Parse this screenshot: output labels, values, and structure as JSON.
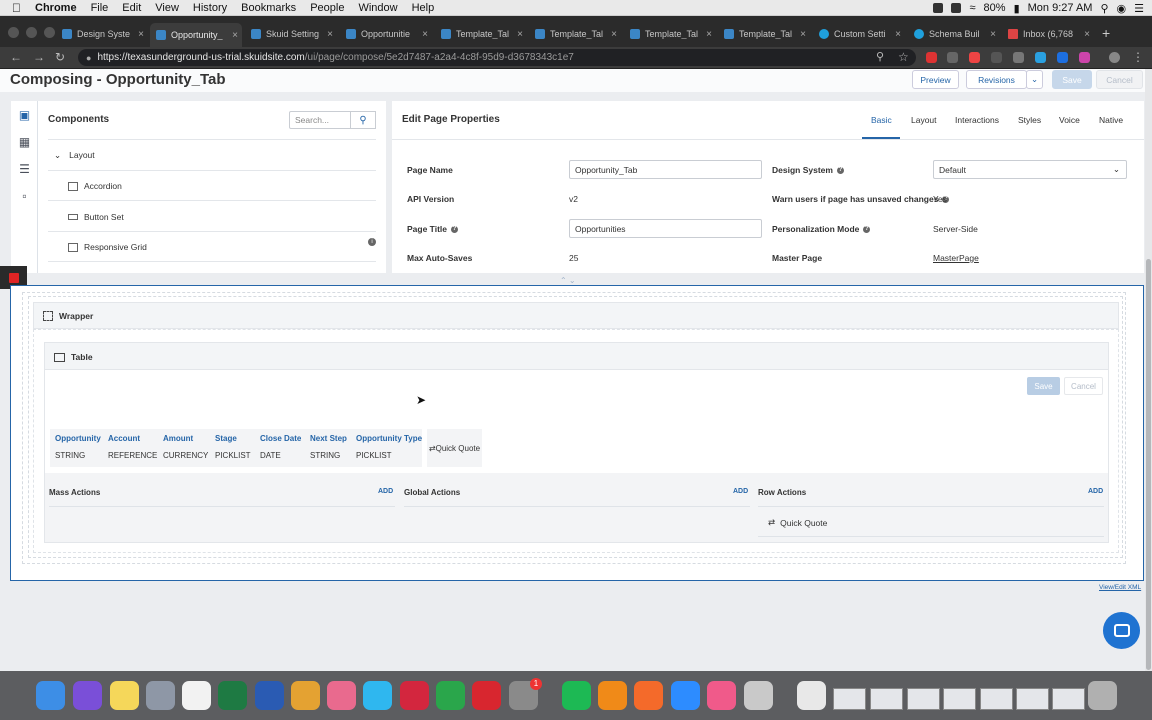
{
  "menubar": {
    "app": "Chrome",
    "items": [
      "File",
      "Edit",
      "View",
      "History",
      "Bookmarks",
      "People",
      "Window",
      "Help"
    ],
    "battery": "80%",
    "clock": "Mon 9:27 AM"
  },
  "tabs": [
    {
      "label": "Design Syste",
      "active": false,
      "icon": "skuid-icon"
    },
    {
      "label": "Opportunity_",
      "active": true,
      "icon": "skuid-icon"
    },
    {
      "label": "Skuid Setting",
      "active": false,
      "icon": "skuid-icon"
    },
    {
      "label": "Opportunitie",
      "active": false,
      "icon": "skuid-icon"
    },
    {
      "label": "Template_Tal",
      "active": false,
      "icon": "skuid-icon"
    },
    {
      "label": "Template_Tal",
      "active": false,
      "icon": "skuid-icon"
    },
    {
      "label": "Template_Tal",
      "active": false,
      "icon": "skuid-icon"
    },
    {
      "label": "Template_Tal",
      "active": false,
      "icon": "skuid-icon"
    },
    {
      "label": "Custom Setti",
      "active": false,
      "icon": "salesforce-icon"
    },
    {
      "label": "Schema Buil",
      "active": false,
      "icon": "salesforce-icon"
    },
    {
      "label": "Inbox (6,768",
      "active": false,
      "icon": "gmail-icon"
    }
  ],
  "address": {
    "host": "https://texasunderground-us-trial.skuidsite.com",
    "path": "/ui/page/compose/5e2d7487-a2a4-4c8f-95d9-d3678343c1e7"
  },
  "page": {
    "title": "Composing - Opportunity_Tab",
    "buttons": {
      "preview": "Preview",
      "revisions": "Revisions",
      "save": "Save",
      "cancel": "Cancel"
    }
  },
  "components": {
    "title": "Components",
    "search_placeholder": "Search...",
    "group": "Layout",
    "items": [
      "Accordion",
      "Button Set",
      "Responsive Grid"
    ]
  },
  "props": {
    "title": "Edit Page Properties",
    "tabs": [
      "Basic",
      "Layout",
      "Interactions",
      "Styles",
      "Voice",
      "Native"
    ],
    "page_name_label": "Page Name",
    "page_name": "Opportunity_Tab",
    "api_version_label": "API Version",
    "api_version": "v2",
    "page_title_label": "Page Title",
    "page_title": "Opportunities",
    "max_autosaves_label": "Max Auto-Saves",
    "max_autosaves": "25",
    "design_system_label": "Design System",
    "design_system": "Default",
    "warn_label": "Warn users if page has unsaved changes",
    "warn": "Yes",
    "personalization_label": "Personalization Mode",
    "personalization": "Server-Side",
    "master_label": "Master Page",
    "master": "MasterPage"
  },
  "canvas": {
    "wrapper": "Wrapper",
    "table": "Table",
    "save": "Save",
    "cancel": "Cancel",
    "columns": [
      {
        "name": "Opportunity",
        "type": "STRING"
      },
      {
        "name": "Account",
        "type": "REFERENCE"
      },
      {
        "name": "Amount",
        "type": "CURRENCY"
      },
      {
        "name": "Stage",
        "type": "PICKLIST"
      },
      {
        "name": "Close Date",
        "type": "DATE"
      },
      {
        "name": "Next Step",
        "type": "STRING"
      },
      {
        "name": "Opportunity Type",
        "type": "PICKLIST"
      }
    ],
    "quick_quote": "Quick Quote",
    "mass_actions": "Mass Actions",
    "global_actions": "Global Actions",
    "row_actions": "Row Actions",
    "add": "ADD",
    "row_action_item": "Quick Quote",
    "view_xml": "View/Edit XML"
  },
  "dock": {
    "badge": "1"
  },
  "colors": {
    "accent": "#2565a8",
    "chat": "#1f73d1",
    "recording": "#e02424"
  }
}
